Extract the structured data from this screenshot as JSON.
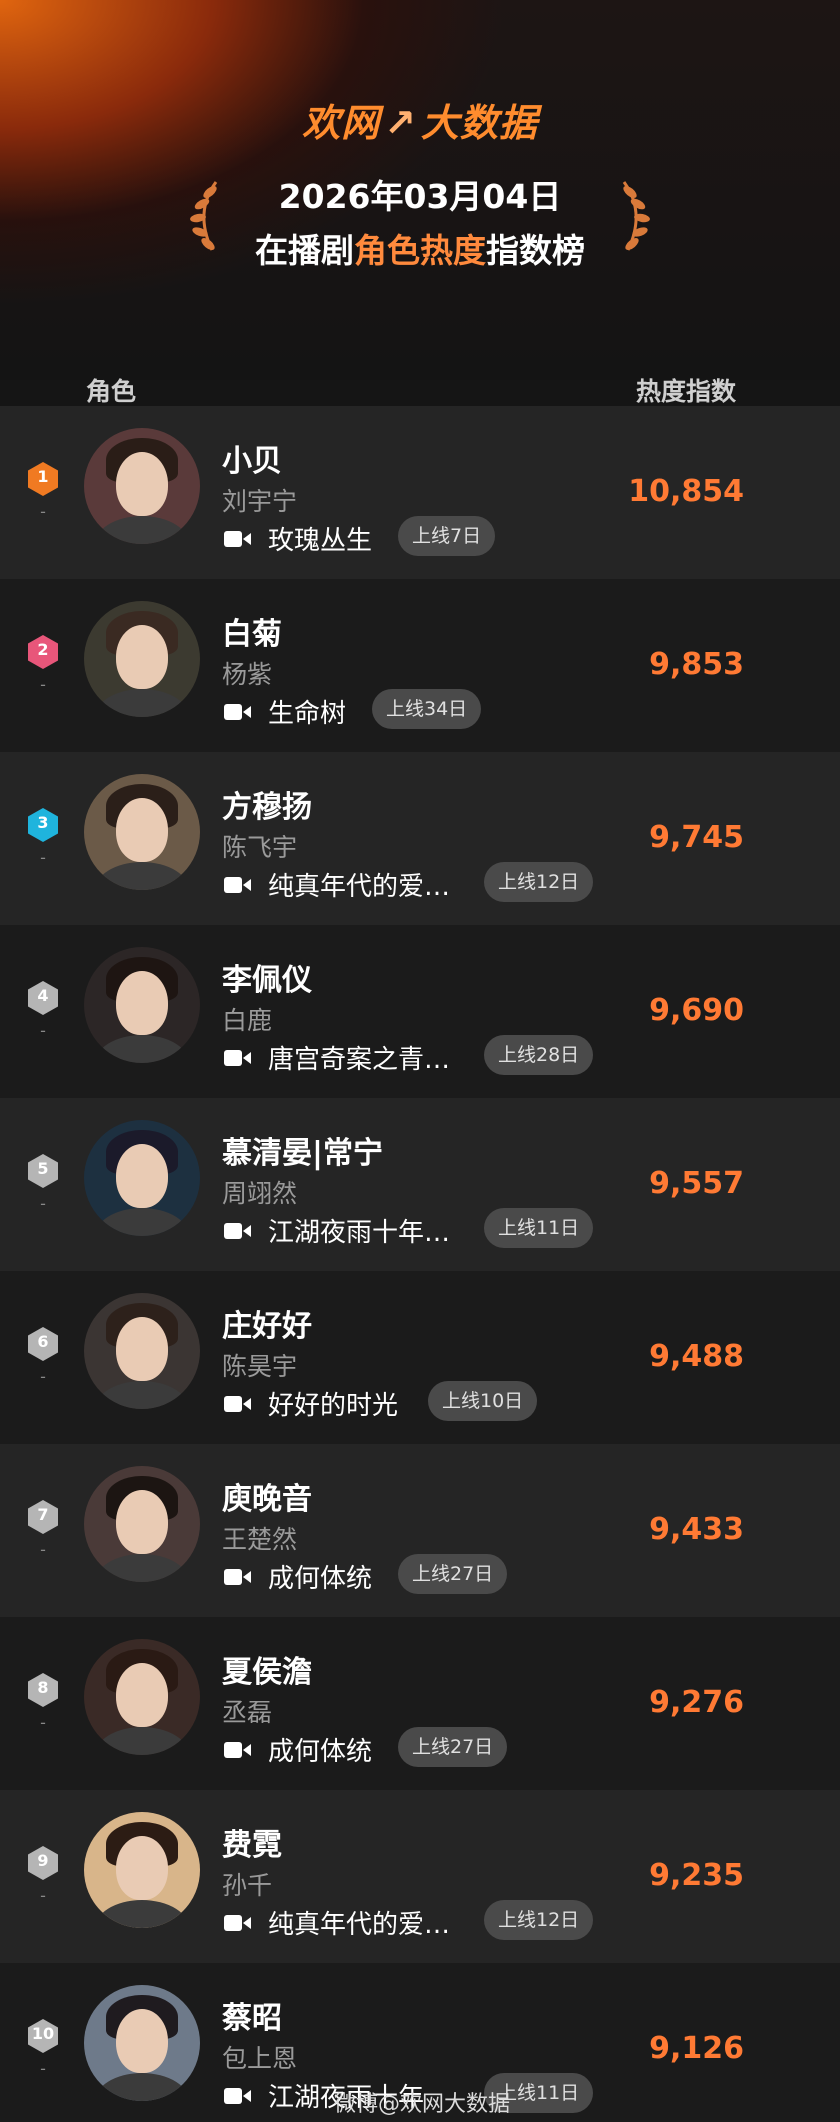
{
  "header": {
    "brand_left": "欢网",
    "brand_right": "大数据",
    "date": "2026年03月04日",
    "title_prefix": "在播剧",
    "title_highlight": "角色热度",
    "title_suffix": "指数榜"
  },
  "columns": {
    "role": "角色",
    "score": "热度指数"
  },
  "colors": {
    "accent": "#ff7a34",
    "rank1": "#f07a22",
    "rank2": "#e8567a",
    "rank3": "#1fb4dd",
    "rank_other": "#b5b5b5"
  },
  "rows": [
    {
      "rank": "1",
      "change": "-",
      "name": "小贝",
      "actor": "刘宇宁",
      "show": "玫瑰丛生",
      "days": "上线7日",
      "score": "10,854"
    },
    {
      "rank": "2",
      "change": "-",
      "name": "白菊",
      "actor": "杨紫",
      "show": "生命树",
      "days": "上线34日",
      "score": "9,853"
    },
    {
      "rank": "3",
      "change": "-",
      "name": "方穆扬",
      "actor": "陈飞宇",
      "show": "纯真年代的爱…",
      "days": "上线12日",
      "score": "9,745"
    },
    {
      "rank": "4",
      "change": "-",
      "name": "李佩仪",
      "actor": "白鹿",
      "show": "唐宫奇案之青…",
      "days": "上线28日",
      "score": "9,690"
    },
    {
      "rank": "5",
      "change": "-",
      "name": "慕清晏|常宁",
      "actor": "周翊然",
      "show": "江湖夜雨十年…",
      "days": "上线11日",
      "score": "9,557"
    },
    {
      "rank": "6",
      "change": "-",
      "name": "庄好好",
      "actor": "陈昊宇",
      "show": "好好的时光",
      "days": "上线10日",
      "score": "9,488"
    },
    {
      "rank": "7",
      "change": "-",
      "name": "庾晚音",
      "actor": "王楚然",
      "show": "成何体统",
      "days": "上线27日",
      "score": "9,433"
    },
    {
      "rank": "8",
      "change": "-",
      "name": "夏侯澹",
      "actor": "丞磊",
      "show": "成何体统",
      "days": "上线27日",
      "score": "9,276"
    },
    {
      "rank": "9",
      "change": "-",
      "name": "费霓",
      "actor": "孙千",
      "show": "纯真年代的爱…",
      "days": "上线12日",
      "score": "9,235"
    },
    {
      "rank": "10",
      "change": "-",
      "name": "蔡昭",
      "actor": "包上恩",
      "show": "江湖夜雨十年",
      "days": "上线11日",
      "score": "9,126"
    }
  ],
  "watermark": "微博@欢网大数据"
}
